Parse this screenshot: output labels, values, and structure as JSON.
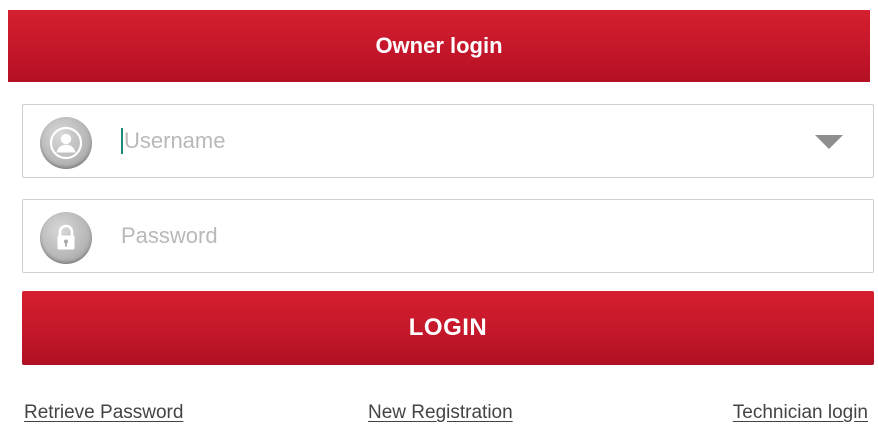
{
  "header": {
    "title": "Owner login"
  },
  "username_field": {
    "placeholder": "Username",
    "value": ""
  },
  "password_field": {
    "placeholder": "Password",
    "value": ""
  },
  "login_button": {
    "label": "LOGIN"
  },
  "links": {
    "retrieve_password": "Retrieve Password",
    "new_registration": "New Registration",
    "technician_login": "Technician login"
  },
  "icons": {
    "username": "user-avatar-icon",
    "password": "padlock-icon",
    "dropdown": "triangle-down-icon"
  },
  "colors": {
    "brand_red": "#c5162a",
    "text_light": "#b9b9b9",
    "link_text": "#444444"
  }
}
